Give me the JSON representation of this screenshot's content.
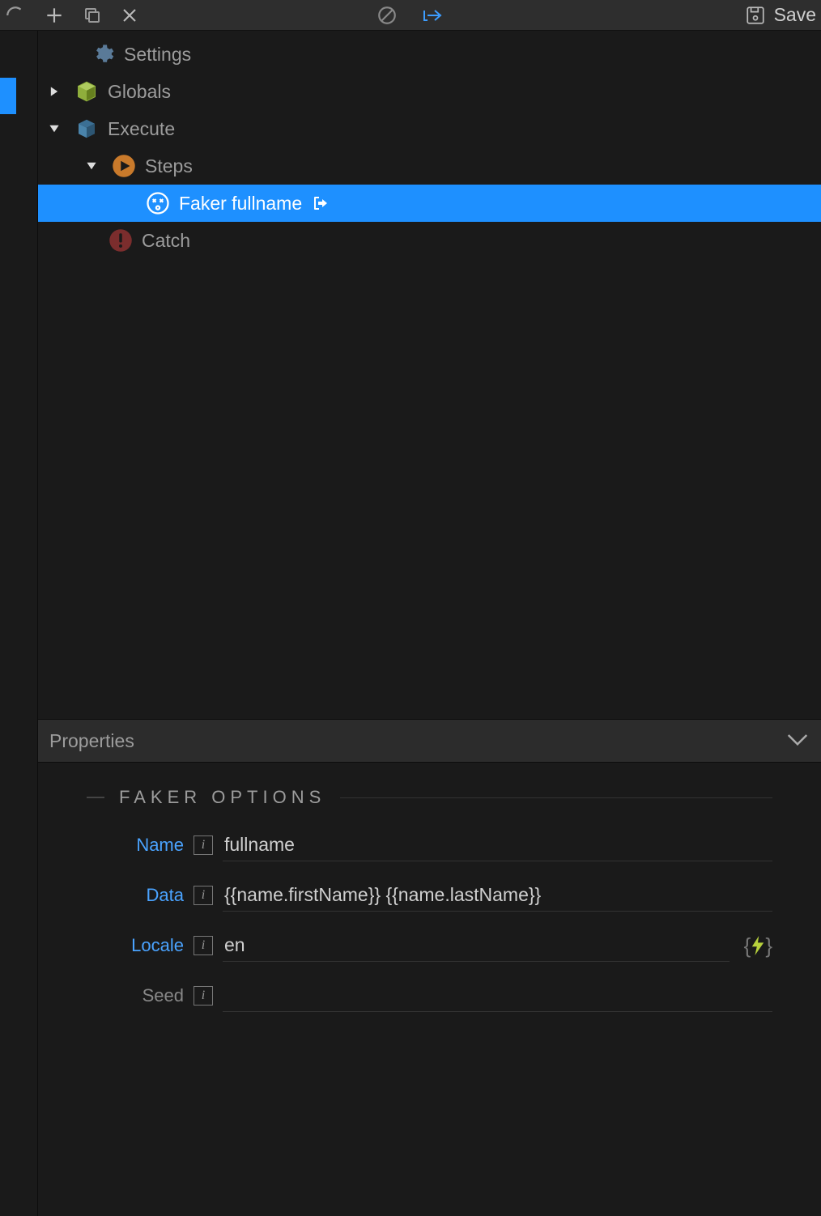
{
  "toolbar": {
    "save_label": "Save"
  },
  "tree": {
    "settings": "Settings",
    "globals": "Globals",
    "execute": "Execute",
    "steps": "Steps",
    "selected": "Faker fullname",
    "catch": "Catch"
  },
  "properties": {
    "header": "Properties",
    "section": "FAKER OPTIONS",
    "fields": {
      "name": {
        "label": "Name",
        "value": "fullname"
      },
      "data": {
        "label": "Data",
        "value": "{{name.firstName}} {{name.lastName}}"
      },
      "locale": {
        "label": "Locale",
        "value": "en"
      },
      "seed": {
        "label": "Seed",
        "value": ""
      }
    }
  }
}
